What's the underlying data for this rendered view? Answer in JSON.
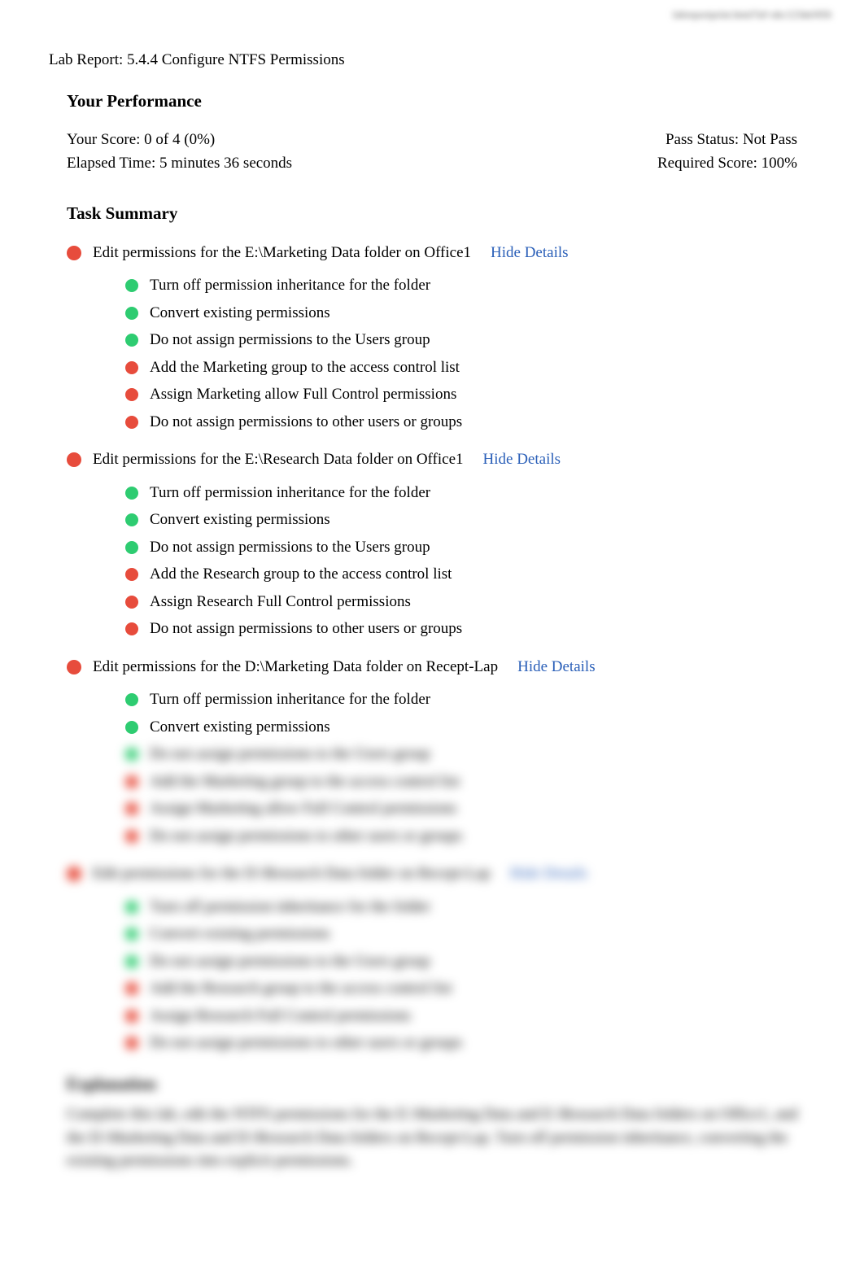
{
  "header_url": "labreportprint.html?id=abc123def456",
  "report_title": "Lab Report: 5.4.4 Configure NTFS Permissions",
  "performance": {
    "heading": "Your Performance",
    "score_label": "Your Score: 0 of 4 (0%)",
    "elapsed_label": "Elapsed Time: 5 minutes 36 seconds",
    "pass_status_label": "Pass Status: Not Pass",
    "required_score_label": "Required Score: 100%"
  },
  "task_summary_heading": "Task Summary",
  "hide_details_label": "Hide Details",
  "tasks": [
    {
      "status": "fail",
      "title": "Edit permissions for the E:\\Marketing Data folder on Office1",
      "subtasks": [
        {
          "status": "pass",
          "text": "Turn off permission inheritance for the folder"
        },
        {
          "status": "pass",
          "text": "Convert existing permissions"
        },
        {
          "status": "pass",
          "text": "Do not assign permissions to the Users group"
        },
        {
          "status": "fail",
          "text": "Add the Marketing group to the access control list"
        },
        {
          "status": "fail",
          "text": "Assign Marketing allow Full Control permissions"
        },
        {
          "status": "fail",
          "text": "Do not assign permissions to other users or groups"
        }
      ]
    },
    {
      "status": "fail",
      "title": "Edit permissions for the E:\\Research Data folder on Office1",
      "subtasks": [
        {
          "status": "pass",
          "text": "Turn off permission inheritance for the folder"
        },
        {
          "status": "pass",
          "text": "Convert existing permissions"
        },
        {
          "status": "pass",
          "text": "Do not assign permissions to the Users group"
        },
        {
          "status": "fail",
          "text": "Add the Research group to the access control list"
        },
        {
          "status": "fail",
          "text": "Assign Research Full Control permissions"
        },
        {
          "status": "fail",
          "text": "Do not assign permissions to other users or groups"
        }
      ]
    },
    {
      "status": "fail",
      "title": "Edit permissions for the D:\\Marketing Data folder on Recept-Lap",
      "subtasks": [
        {
          "status": "pass",
          "text": "Turn off permission inheritance for the folder"
        },
        {
          "status": "pass",
          "text": "Convert existing permissions"
        },
        {
          "status": "pass",
          "text": "Do not assign permissions to the Users group",
          "blurred": true
        },
        {
          "status": "fail",
          "text": "Add the Marketing group to the access control list",
          "blurred": true
        },
        {
          "status": "fail",
          "text": "Assign Marketing allow Full Control permissions",
          "blurred": true
        },
        {
          "status": "fail",
          "text": "Do not assign permissions to other users or groups",
          "blurred": true
        }
      ]
    },
    {
      "status": "fail",
      "title": "Edit permissions for the D:\\Research Data folder on Recept-Lap",
      "blurred": true,
      "subtasks": [
        {
          "status": "pass",
          "text": "Turn off permission inheritance for the folder",
          "blurred": true
        },
        {
          "status": "pass",
          "text": "Convert existing permissions",
          "blurred": true
        },
        {
          "status": "pass",
          "text": "Do not assign permissions to the Users group",
          "blurred": true
        },
        {
          "status": "fail",
          "text": "Add the Research group to the access control list",
          "blurred": true
        },
        {
          "status": "fail",
          "text": "Assign Research Full Control permissions",
          "blurred": true
        },
        {
          "status": "fail",
          "text": "Do not assign permissions to other users or groups",
          "blurred": true
        }
      ]
    }
  ],
  "explanation": {
    "heading": "Explanation",
    "body": "Complete this lab, edit the NTFS permissions for the E:\\Marketing Data and E:\\Research Data folders on Office1, and the D:\\Marketing Data and D:\\Research Data folders on Recept-Lap.\n\nTurn off permission inheritance, converting the existing permissions into explicit permissions."
  }
}
